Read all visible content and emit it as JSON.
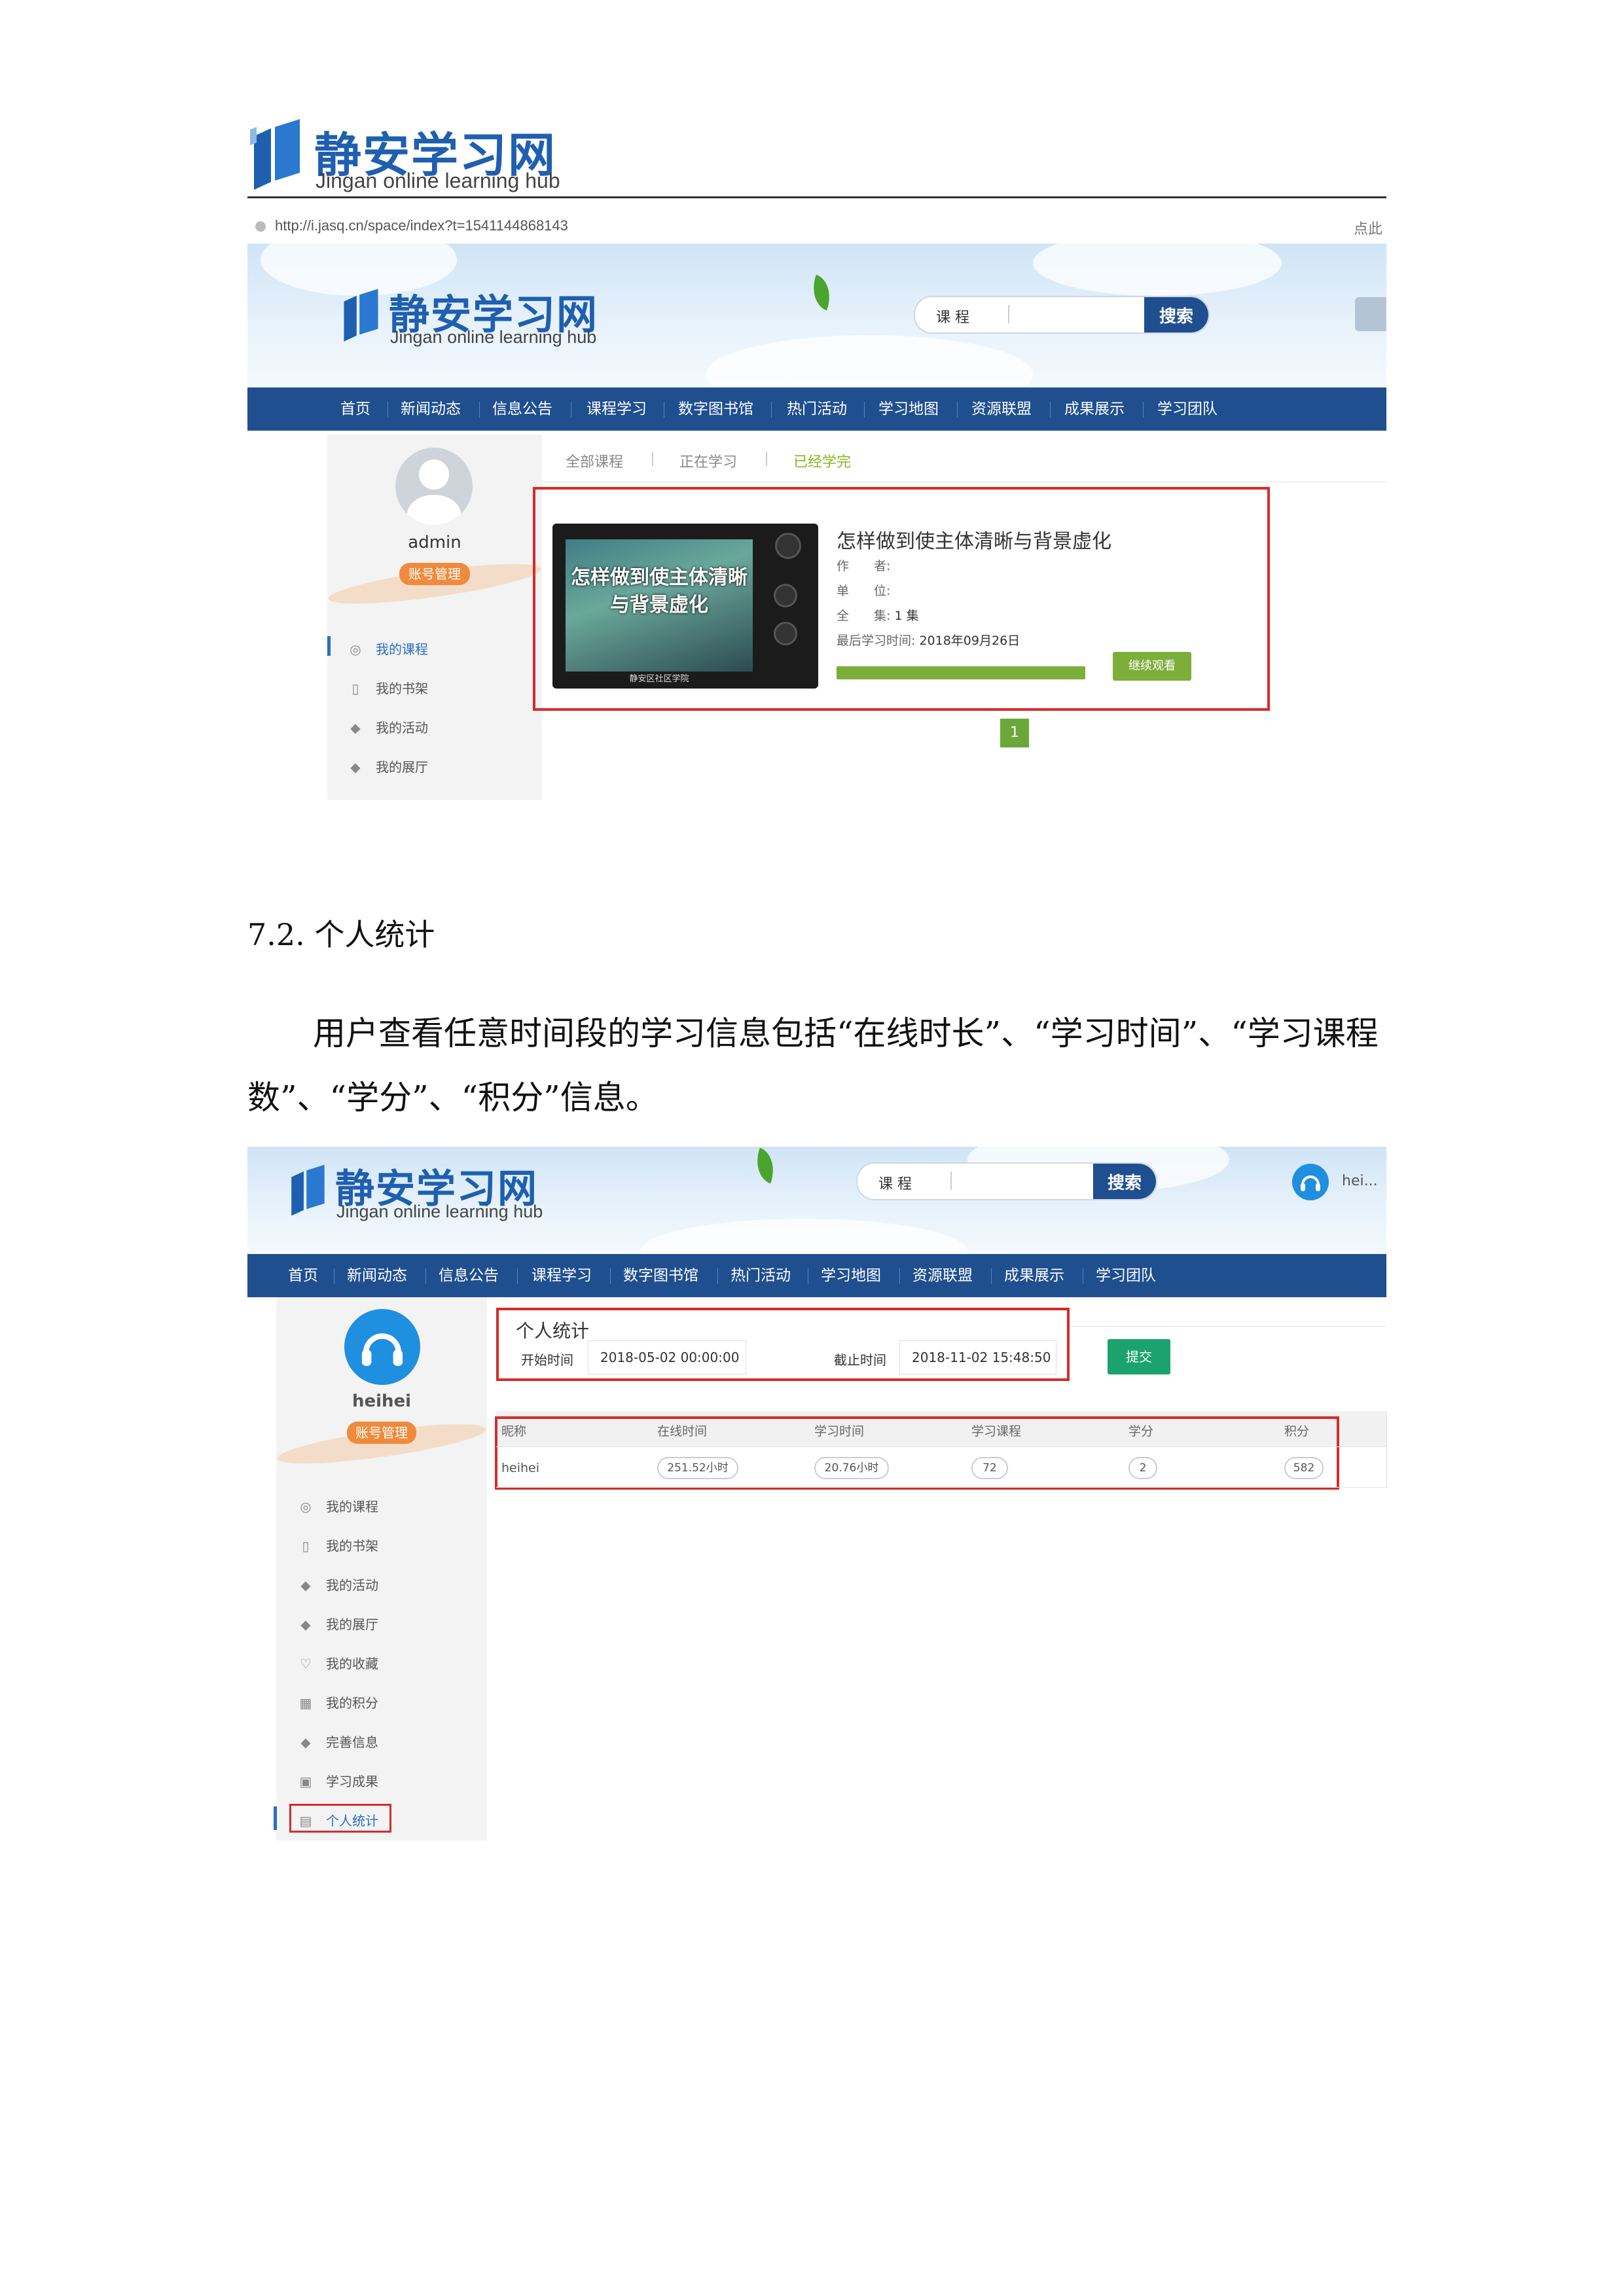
{
  "doc_logo": {
    "cn": "静安学习网",
    "en": "Jingan online learning hub"
  },
  "browser": {
    "url": "http://i.jasq.cn/space/index?t=1541144868143",
    "right_text": "点此"
  },
  "site": {
    "logo_cn": "静安学习网",
    "logo_en": "Jingan online learning hub",
    "search_category": "课 程",
    "search_button": "搜索",
    "nav": [
      "首页",
      "新闻动态",
      "信息公告",
      "课程学习",
      "数字图书馆",
      "热门活动",
      "学习地图",
      "资源联盟",
      "成果展示",
      "学习团队"
    ]
  },
  "shot1": {
    "username": "admin",
    "account_button": "账号管理",
    "menu": [
      "我的课程",
      "我的书架",
      "我的活动",
      "我的展厅"
    ],
    "tabs": [
      "全部课程",
      "正在学习",
      "已经学完"
    ],
    "course": {
      "thumb_title": "怎样做到使主体清晰与背景虚化",
      "thumb_caption": "静安区社区学院",
      "title": "怎样做到使主体清晰与背景虚化",
      "author_label": "作　　者:",
      "unit_label": "单　　位:",
      "episodes_label": "全　　集:",
      "episodes_value": "1 集",
      "last_time_label": "最后学习时间:",
      "last_time_value": "2018年09月26日",
      "progress": 1.0,
      "continue_button": "继续观看"
    },
    "page_number": "1"
  },
  "section": {
    "heading": "7.2.  个人统计",
    "paragraph": "用户查看任意时间段的学习信息包括“在线时长”、“学习时间”、“学习课程数”、“学分”、“积分”信息。"
  },
  "shot2": {
    "user_short": "hei...",
    "username": "heihei",
    "account_button": "账号管理",
    "menu": [
      "我的课程",
      "我的书架",
      "我的活动",
      "我的展厅",
      "我的收藏",
      "我的积分",
      "完善信息",
      "学习成果",
      "个人统计"
    ],
    "stat_title": "个人统计",
    "start_label": "开始时间",
    "start_value": "2018-05-02 00:00:00",
    "end_label": "截止时间",
    "end_value": "2018-11-02 15:48:50",
    "submit_button": "提交",
    "table": {
      "headers": [
        "昵称",
        "在线时间",
        "学习时间",
        "学习课程",
        "学分",
        "积分"
      ],
      "row": [
        "heihei",
        "251.52小时",
        "20.76小时",
        "72",
        "2",
        "582"
      ]
    }
  }
}
